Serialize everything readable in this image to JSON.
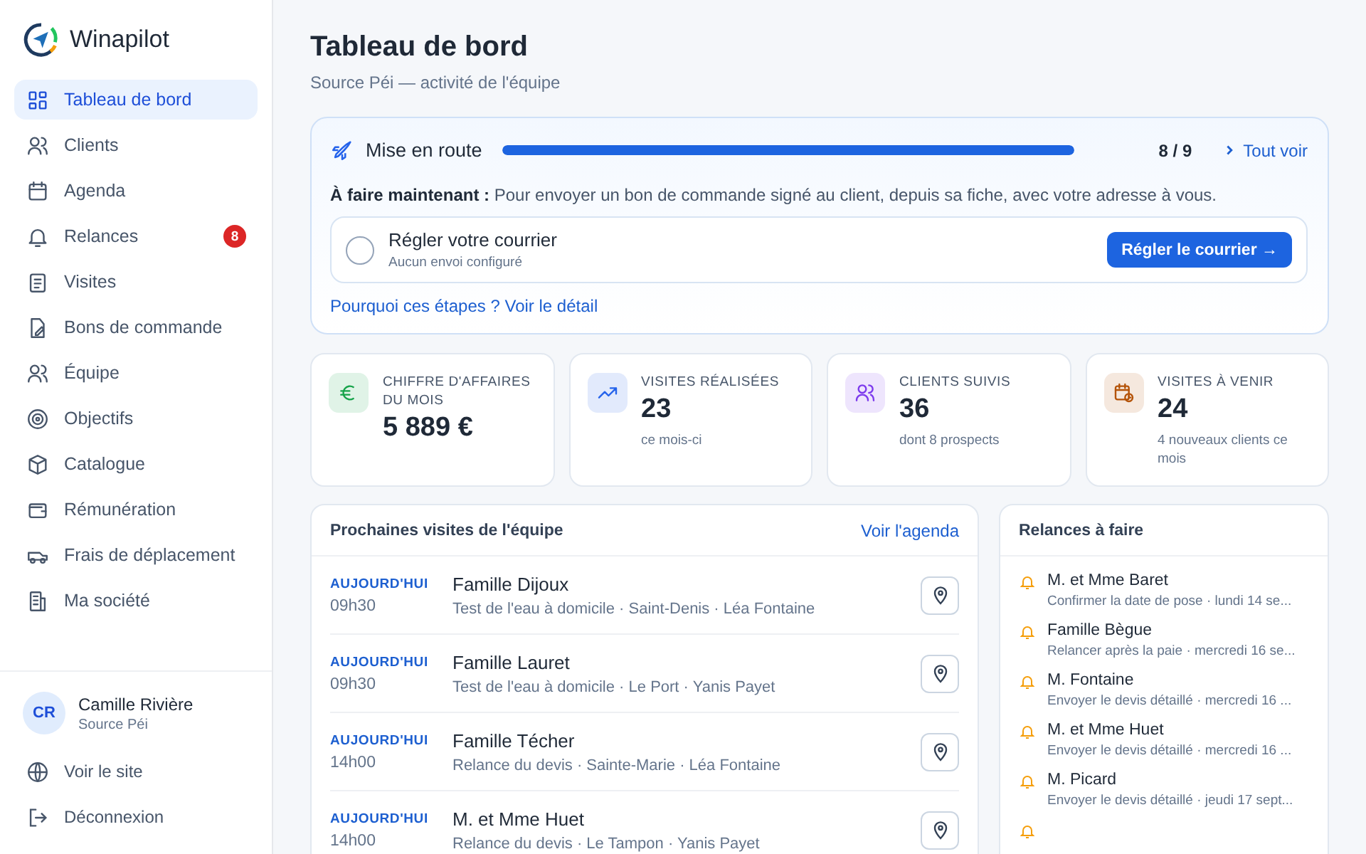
{
  "brand": {
    "name": "Winapilot"
  },
  "sidebar": {
    "items": [
      {
        "label": "Tableau de bord",
        "selected": true
      },
      {
        "label": "Clients",
        "selected": false
      },
      {
        "label": "Agenda",
        "selected": false
      },
      {
        "label": "Relances",
        "selected": false,
        "badge": "8"
      },
      {
        "label": "Visites",
        "selected": false
      },
      {
        "label": "Bons de commande",
        "selected": false
      },
      {
        "label": "Équipe",
        "selected": false
      },
      {
        "label": "Objectifs",
        "selected": false
      },
      {
        "label": "Catalogue",
        "selected": false
      },
      {
        "label": "Rémunération",
        "selected": false
      },
      {
        "label": "Frais de déplacement",
        "selected": false
      },
      {
        "label": "Ma société",
        "selected": false
      }
    ],
    "user": {
      "initials": "CR",
      "name": "Camille Rivière",
      "company": "Source Péi"
    },
    "footer_links": [
      "Voir le site",
      "Déconnexion"
    ]
  },
  "header": {
    "title": "Tableau de bord",
    "subtitle": "Source Péi — activité de l'équipe"
  },
  "onboarding": {
    "title": "Mise en route",
    "level": 1,
    "count": "8 / 9",
    "see_all": "Tout voir",
    "todo": "**À faire maintenant :** Pour envoyer un bon de commande signé au client, depuis sa fiche, avec votre adresse à vous.",
    "step": {
      "title": "Régler votre courrier",
      "subtitle": "Aucun envoi configuré",
      "checked": false,
      "button": "Régler le courrier →"
    },
    "why_link": "Pourquoi ces étapes ? Voir le détail"
  },
  "stats": [
    {
      "label": "CHIFFRE D'AFFAIRES DU MOIS",
      "value": "5 889 €",
      "color": "#16a34a"
    },
    {
      "label": "VISITES RÉALISÉES",
      "value": "23",
      "note": "ce mois-ci",
      "color": "#2563eb"
    },
    {
      "label": "CLIENTS SUIVIS",
      "value": "36",
      "note": "dont 8 prospects",
      "color": "#7c3aed"
    },
    {
      "label": "VISITES À VENIR",
      "value": "24",
      "note": "4 nouveaux clients ce mois",
      "color": "#b45309"
    }
  ],
  "visits": {
    "title": "Prochaines visites de l'équipe",
    "link": "Voir l'agenda",
    "rows": [
      {
        "day": "AUJOURD'HUI",
        "time": "09h30",
        "name": "Famille Dijoux",
        "detail": "Test de l'eau à domicile · Saint-Denis · Léa Fontaine"
      },
      {
        "day": "AUJOURD'HUI",
        "time": "09h30",
        "name": "Famille Lauret",
        "detail": "Test de l'eau à domicile · Le Port · Yanis Payet"
      },
      {
        "day": "AUJOURD'HUI",
        "time": "14h00",
        "name": "Famille Técher",
        "detail": "Relance du devis · Sainte-Marie · Léa Fontaine"
      },
      {
        "day": "AUJOURD'HUI",
        "time": "14h00",
        "name": "M. et Mme Huet",
        "detail": "Relance du devis · Le Tampon · Yanis Payet"
      }
    ]
  },
  "reminders": {
    "title": "Relances à faire",
    "items": [
      {
        "name": "M. et Mme Baret",
        "detail": "Confirmer la date de pose · lundi 14 se..."
      },
      {
        "name": "Famille Bègue",
        "detail": "Relancer après la paie · mercredi 16 se..."
      },
      {
        "name": "M. Fontaine",
        "detail": "Envoyer le devis détaillé · mercredi 16 ..."
      },
      {
        "name": "M. et Mme Huet",
        "detail": "Envoyer le devis détaillé · mercredi 16 ..."
      },
      {
        "name": "M. Picard",
        "detail": "Envoyer le devis détaillé · jeudi 17 sept..."
      }
    ]
  }
}
